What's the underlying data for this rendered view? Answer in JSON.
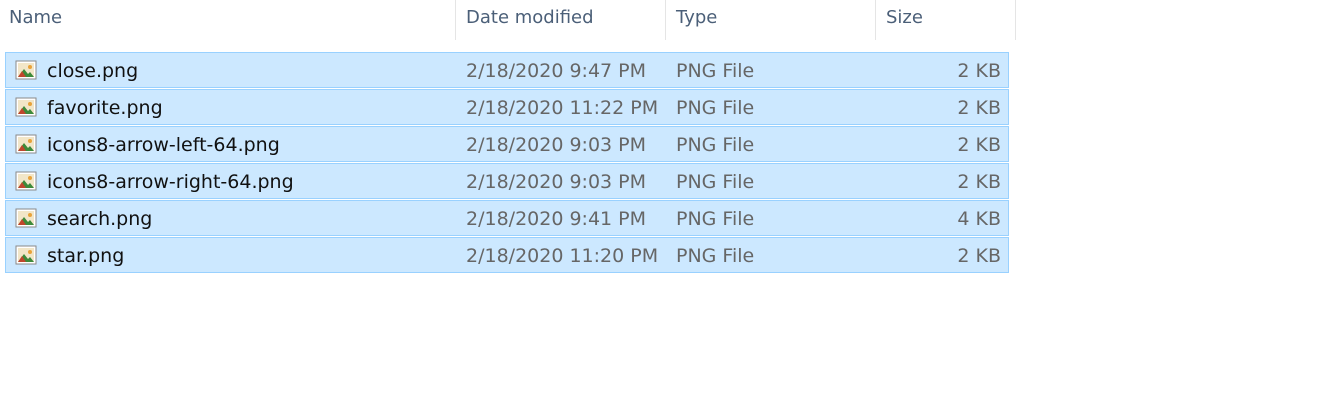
{
  "columns": {
    "name": "Name",
    "date_modified": "Date modified",
    "type": "Type",
    "size": "Size"
  },
  "files": [
    {
      "name": "close.png",
      "date_modified": "2/18/2020 9:47 PM",
      "type": "PNG File",
      "size": "2 KB",
      "icon": "image-file-icon"
    },
    {
      "name": "favorite.png",
      "date_modified": "2/18/2020 11:22 PM",
      "type": "PNG File",
      "size": "2 KB",
      "icon": "image-file-icon"
    },
    {
      "name": "icons8-arrow-left-64.png",
      "date_modified": "2/18/2020 9:03 PM",
      "type": "PNG File",
      "size": "2 KB",
      "icon": "image-file-icon"
    },
    {
      "name": "icons8-arrow-right-64.png",
      "date_modified": "2/18/2020 9:03 PM",
      "type": "PNG File",
      "size": "2 KB",
      "icon": "image-file-icon"
    },
    {
      "name": "search.png",
      "date_modified": "2/18/2020 9:41 PM",
      "type": "PNG File",
      "size": "4 KB",
      "icon": "image-file-icon"
    },
    {
      "name": "star.png",
      "date_modified": "2/18/2020 11:20 PM",
      "type": "PNG File",
      "size": "2 KB",
      "icon": "image-file-icon"
    }
  ],
  "colors": {
    "selection_background": "#cce8ff",
    "selection_border": "#99d1ff",
    "header_text": "#4b5f78"
  }
}
